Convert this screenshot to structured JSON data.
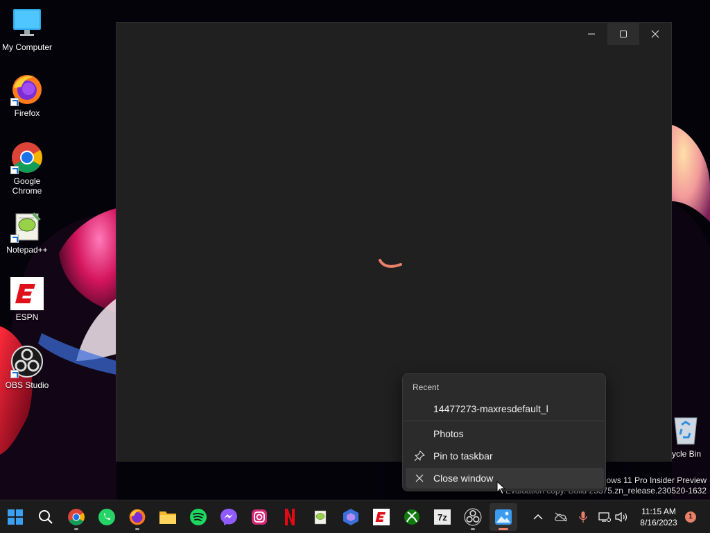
{
  "desktop": {
    "icons": [
      {
        "label": "My Computer",
        "icon": "monitor-icon"
      },
      {
        "label": "Firefox",
        "icon": "firefox-icon"
      },
      {
        "label": "Google Chrome",
        "icon": "chrome-icon"
      },
      {
        "label": "Notepad++",
        "icon": "notepadpp-icon"
      },
      {
        "label": "ESPN",
        "icon": "espn-icon"
      },
      {
        "label": "OBS Studio",
        "icon": "obs-icon"
      }
    ],
    "recycle_bin_label": "ycle Bin",
    "watermark_line1": "dows 11 Pro Insider Preview",
    "watermark_line2": "Evaluation copy. Build 25375.zn_release.230520-1632"
  },
  "window": {
    "minimize_glyph": "—",
    "maximize_glyph": "☐",
    "close_glyph": "✕",
    "state": "loading"
  },
  "jumplist": {
    "heading": "Recent",
    "recent_items": [
      "14477273-maxresdefault_l"
    ],
    "app_name": "Photos",
    "pin_label": "Pin to taskbar",
    "close_label": "Close window"
  },
  "taskbar": {
    "apps": [
      {
        "name": "start-button",
        "icon": "windows-icon"
      },
      {
        "name": "search-button",
        "icon": "search-icon"
      },
      {
        "name": "chrome",
        "icon": "chrome-icon"
      },
      {
        "name": "whatsapp",
        "icon": "whatsapp-icon"
      },
      {
        "name": "firefox",
        "icon": "firefox-icon"
      },
      {
        "name": "file-explorer",
        "icon": "folder-icon"
      },
      {
        "name": "spotify",
        "icon": "spotify-icon"
      },
      {
        "name": "messenger",
        "icon": "messenger-icon"
      },
      {
        "name": "instagram",
        "icon": "instagram-icon"
      },
      {
        "name": "netflix",
        "icon": "netflix-icon"
      },
      {
        "name": "notepadpp",
        "icon": "notepadpp-icon"
      },
      {
        "name": "copilot",
        "icon": "copilot-icon"
      },
      {
        "name": "espn",
        "icon": "espn-icon"
      },
      {
        "name": "xbox",
        "icon": "xbox-icon"
      },
      {
        "name": "7zip",
        "icon": "7zip-icon",
        "label": "7z"
      },
      {
        "name": "obs",
        "icon": "obs-icon"
      },
      {
        "name": "photos",
        "icon": "photos-icon"
      }
    ],
    "time": "11:15 AM",
    "date": "8/16/2023",
    "notification_count": "1"
  },
  "colors": {
    "accent": "#e8806a",
    "window_bg": "#202020",
    "taskbar_bg": "#1c1c1c",
    "menu_bg": "#2b2b2b"
  }
}
